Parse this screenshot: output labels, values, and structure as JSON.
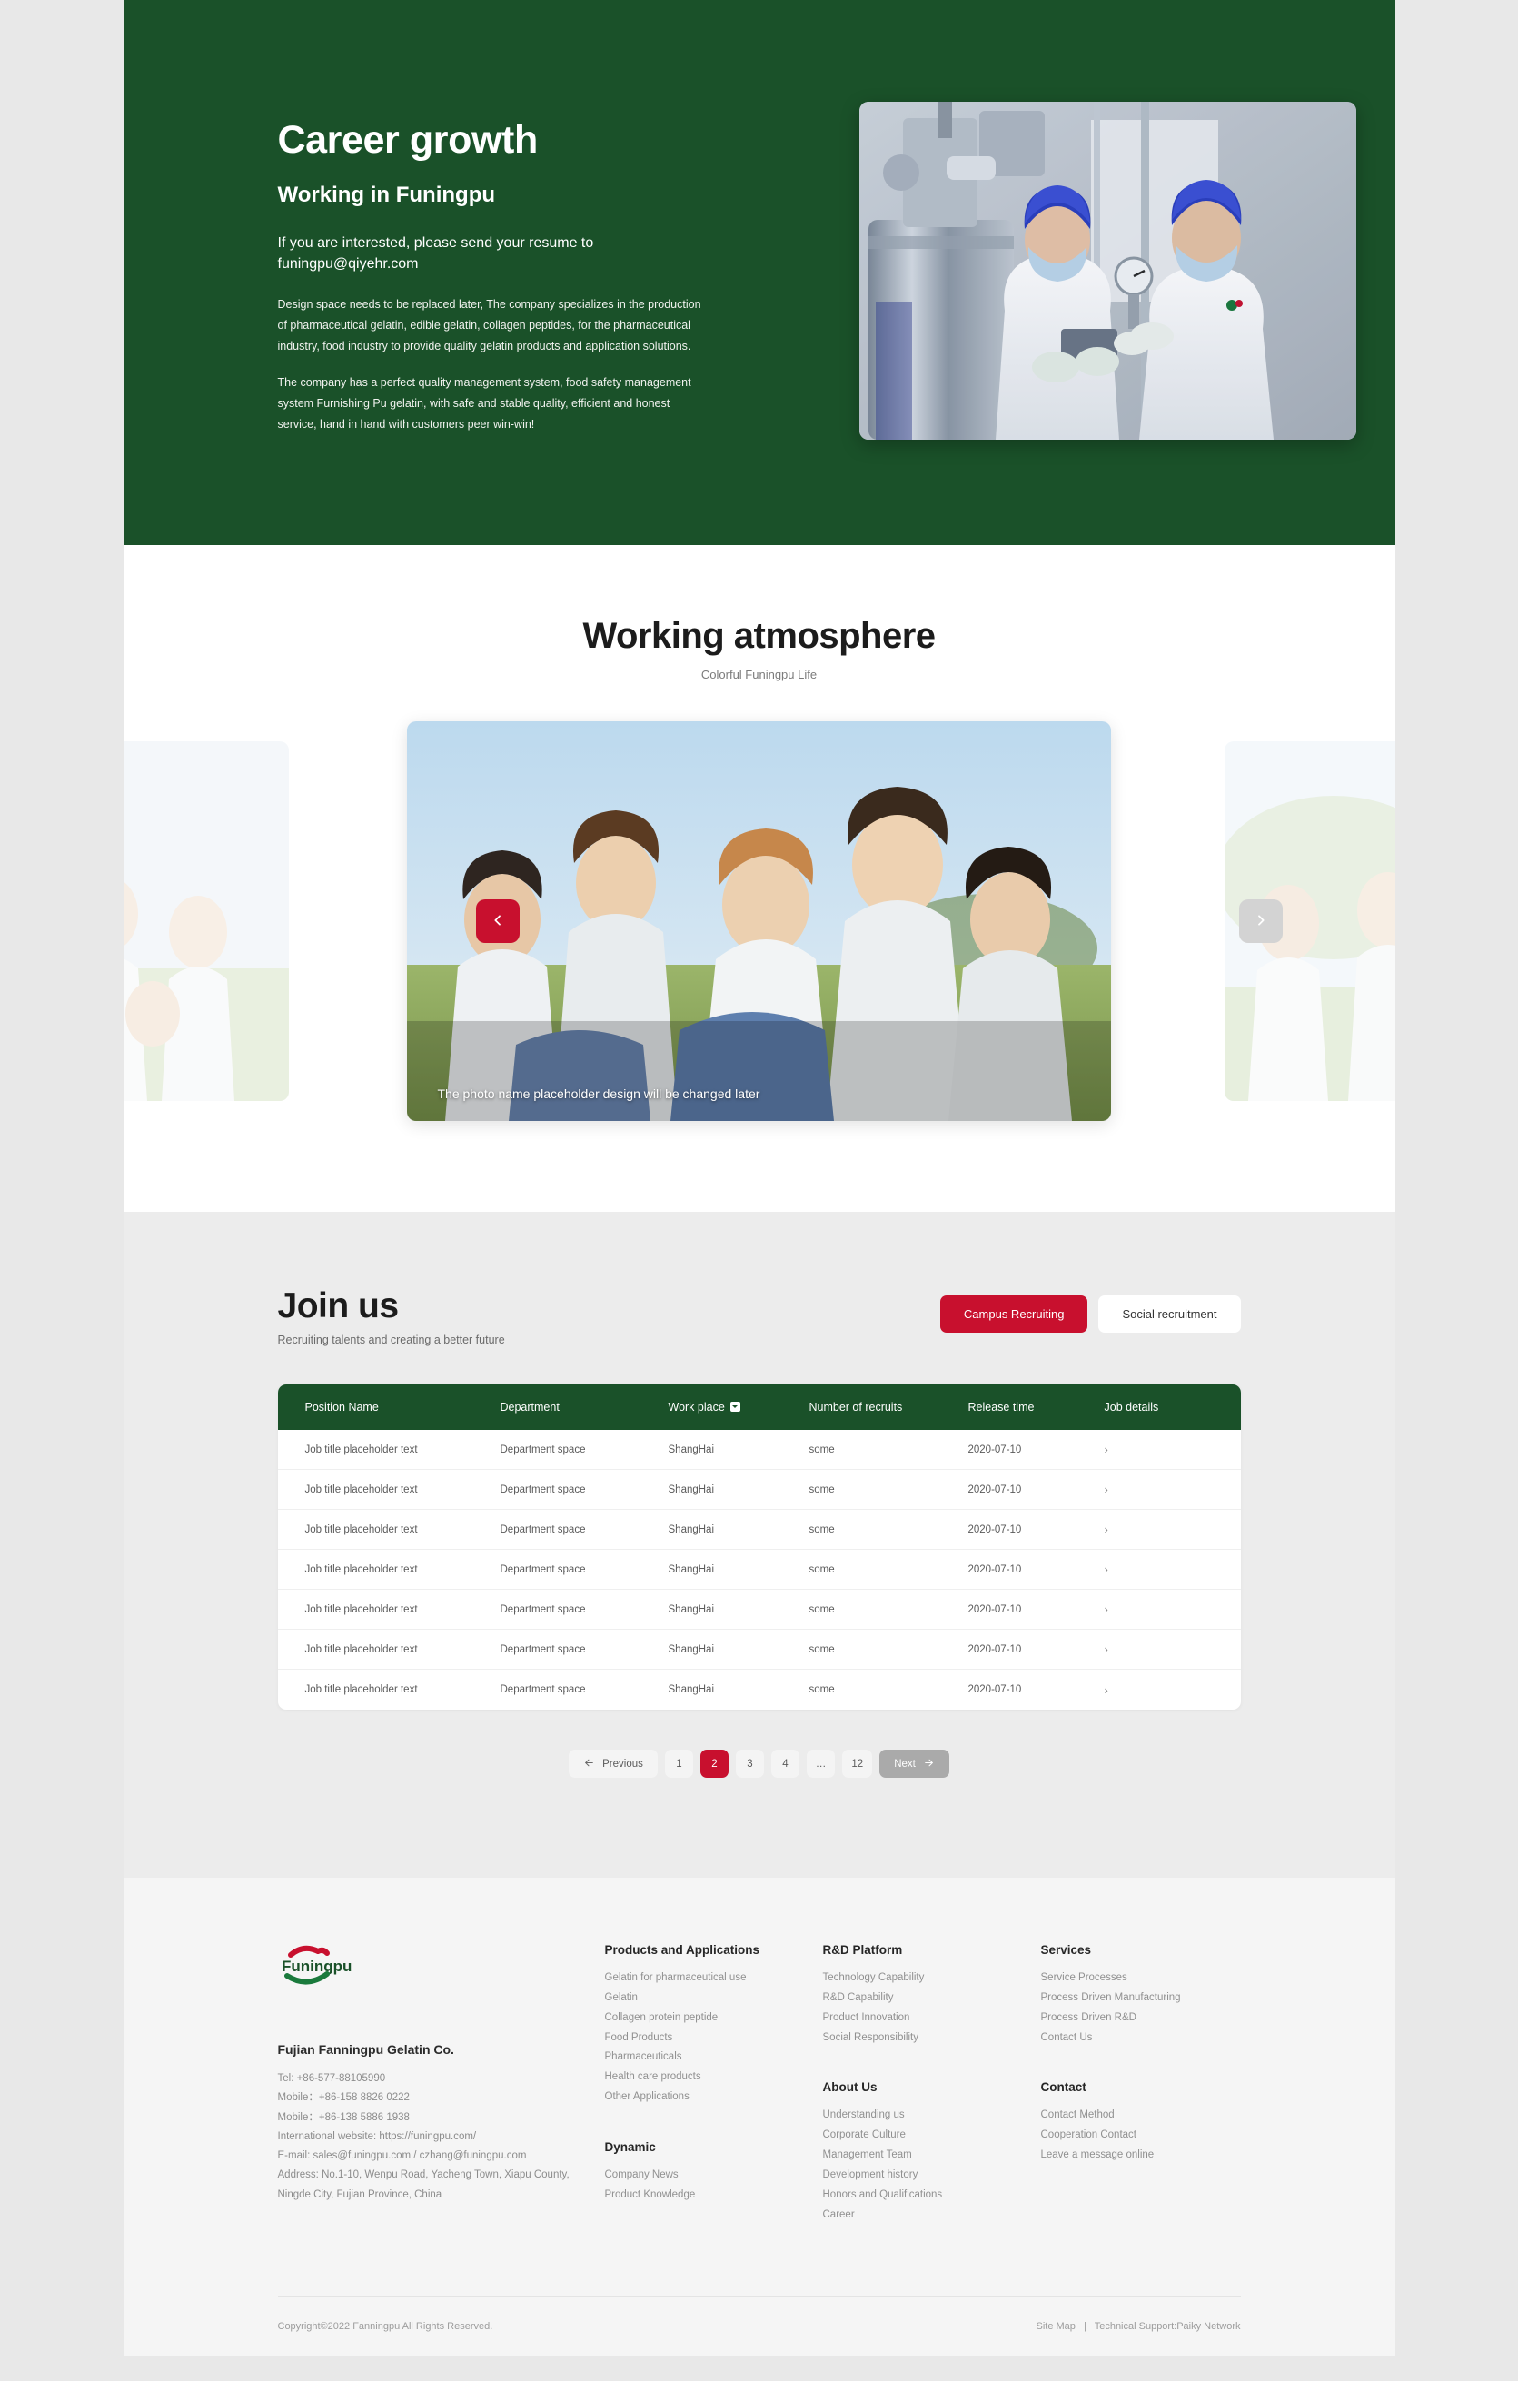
{
  "hero": {
    "title": "Career growth",
    "subtitle": "Working in Funingpu",
    "lead": "If you are interested, please send your resume to funingpu@qiyehr.com",
    "paragraph1": "Design space needs to be replaced later,   The company specializes in the production of pharmaceutical gelatin, edible gelatin, collagen peptides, for the pharmaceutical industry, food industry to provide quality gelatin products and application solutions.",
    "paragraph2": "The company has a perfect quality management system, food safety management system Furnishing Pu gelatin, with safe and stable quality, efficient and honest service, hand in hand with customers peer win-win!",
    "image_alt": "two-lab-workers-inspecting-tablet-in-pharmaceutical-plant",
    "background_color": "#1a5129"
  },
  "atmosphere": {
    "title": "Working atmosphere",
    "subtitle": "Colorful Funingpu Life",
    "slide_caption": "The photo name placeholder design will be changed later",
    "prev_icon": "chevron-left-icon",
    "next_icon": "chevron-right-icon",
    "prev_color": "#c8102e",
    "next_color": "#d3d3d3"
  },
  "join": {
    "title": "Join us",
    "subtitle": "Recruiting talents and creating a better future",
    "tabs": [
      {
        "label": "Campus Recruiting",
        "active": true
      },
      {
        "label": "Social recruitment",
        "active": false
      }
    ],
    "table": {
      "headers": [
        "Position Name",
        "Department",
        "Work place",
        "Number of recruits",
        "Release time",
        "Job details"
      ],
      "workplace_filter_icon": "chevron-down-icon",
      "row_detail_icon": "chevron-right-icon",
      "rows": [
        {
          "position": "Job title placeholder text",
          "department": "Department space",
          "workplace": "ShangHai",
          "recruits": "some",
          "release": "2020-07-10"
        },
        {
          "position": "Job title placeholder text",
          "department": "Department space",
          "workplace": "ShangHai",
          "recruits": "some",
          "release": "2020-07-10"
        },
        {
          "position": "Job title placeholder text",
          "department": "Department space",
          "workplace": "ShangHai",
          "recruits": "some",
          "release": "2020-07-10"
        },
        {
          "position": "Job title placeholder text",
          "department": "Department space",
          "workplace": "ShangHai",
          "recruits": "some",
          "release": "2020-07-10"
        },
        {
          "position": "Job title placeholder text",
          "department": "Department space",
          "workplace": "ShangHai",
          "recruits": "some",
          "release": "2020-07-10"
        },
        {
          "position": "Job title placeholder text",
          "department": "Department space",
          "workplace": "ShangHai",
          "recruits": "some",
          "release": "2020-07-10"
        },
        {
          "position": "Job title placeholder text",
          "department": "Department space",
          "workplace": "ShangHai",
          "recruits": "some",
          "release": "2020-07-10"
        }
      ]
    },
    "pagination": {
      "previous_label": "Previous",
      "next_label": "Next",
      "pages": [
        "1",
        "2",
        "3",
        "4",
        "…",
        "12"
      ],
      "current_page": "2",
      "prev_icon": "arrow-left-icon",
      "next_icon": "arrow-right-icon",
      "active_color": "#c8102e"
    }
  },
  "footer": {
    "logo_text": "Funingpu",
    "company": "Fujian Fanningpu Gelatin Co.",
    "contact_lines": [
      "Tel: +86-577-88105990",
      "Mobile：+86-158 8826 0222",
      "Mobile：+86-138 5886 1938",
      "International website: https://funingpu.com/",
      "E-mail: sales@funingpu.com / czhang@funingpu.com",
      "Address: No.1-10, Wenpu Road, Yacheng Town, Xiapu County,",
      "Ningde City, Fujian Province, China"
    ],
    "columns": [
      {
        "groups": [
          {
            "heading": "Products and Applications",
            "links": [
              "Gelatin for pharmaceutical use",
              "Gelatin",
              "Collagen protein peptide",
              "Food Products",
              "Pharmaceuticals",
              "Health care products",
              "Other Applications"
            ]
          },
          {
            "heading": "Dynamic",
            "links": [
              "Company News",
              "Product Knowledge"
            ]
          }
        ]
      },
      {
        "groups": [
          {
            "heading": "R&D Platform",
            "links": [
              "Technology Capability",
              "R&D Capability",
              "Product Innovation",
              "Social Responsibility"
            ]
          },
          {
            "heading": "About Us",
            "links": [
              "Understanding us",
              "Corporate Culture",
              "Management Team",
              "Development history",
              "Honors and Qualifications",
              "Career"
            ]
          }
        ]
      },
      {
        "groups": [
          {
            "heading": "Services",
            "links": [
              "Service Processes",
              "Process Driven Manufacturing",
              "Process Driven R&D",
              "Contact Us"
            ]
          },
          {
            "heading": "Contact",
            "links": [
              "Contact Method",
              "Cooperation Contact",
              "Leave a message online"
            ]
          }
        ]
      }
    ],
    "copyright": "Copyright©2022 Fanningpu All Rights Reserved.",
    "site_map": "Site Map",
    "separator": "|",
    "technical_support": "Technical Support:Paiky Network"
  }
}
